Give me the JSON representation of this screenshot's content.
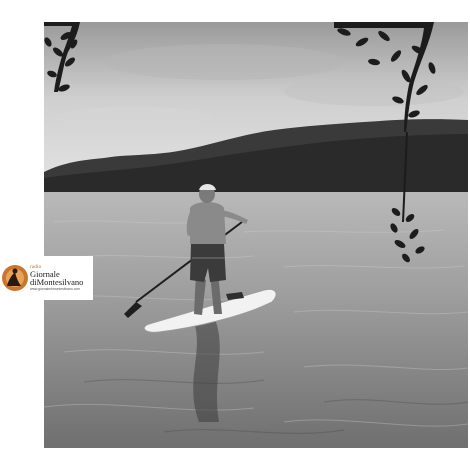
{
  "logo": {
    "prefix": "radio",
    "title_line1": "Giornale",
    "title_line2": "diMontesilvano",
    "url": "www.giornaledimontesilvano.com",
    "accent_color": "#c9772f"
  },
  "photo": {
    "style": "black-and-white",
    "subject": "paddleboard"
  }
}
